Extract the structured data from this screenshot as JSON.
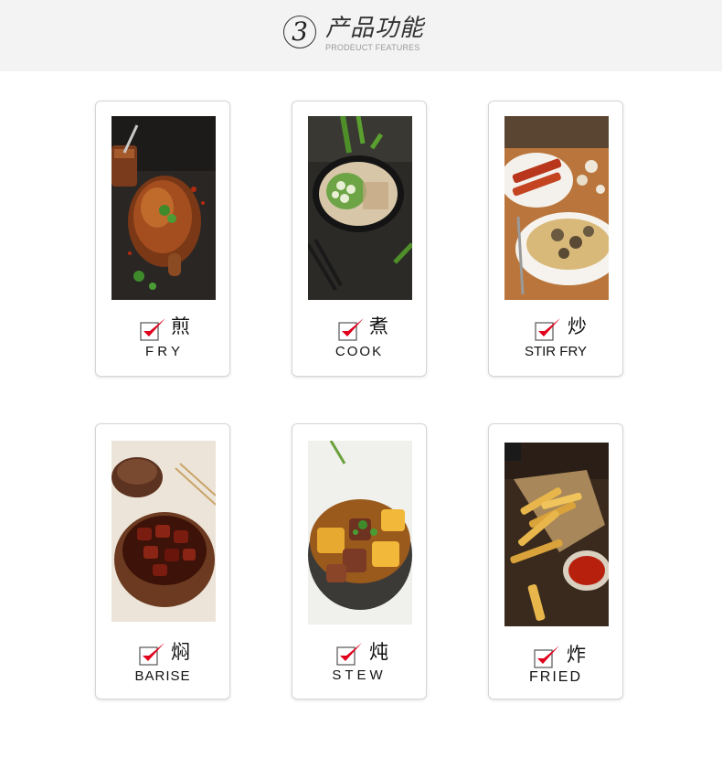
{
  "header": {
    "number": "3",
    "title": "产品功能",
    "subtitle": "PRODEUCT FEATURES"
  },
  "features": [
    {
      "cn": "煎",
      "en": "F R Y",
      "photo": "roast-chicken-leg"
    },
    {
      "cn": "煮",
      "en": "COOK",
      "photo": "okra-noodle-soup"
    },
    {
      "cn": "炒",
      "en": "STIR FRY",
      "photo": "mushroom-pasta"
    },
    {
      "cn": "焖",
      "en": "BARISE",
      "photo": "braised-pork-clay-pot"
    },
    {
      "cn": "炖",
      "en": "STEW",
      "photo": "beef-potato-stew"
    },
    {
      "cn": "炸",
      "en": "FRIED",
      "photo": "french-fries-ketchup"
    }
  ],
  "colors": {
    "check": "#e0001b",
    "header_bg": "#f3f3f3"
  }
}
